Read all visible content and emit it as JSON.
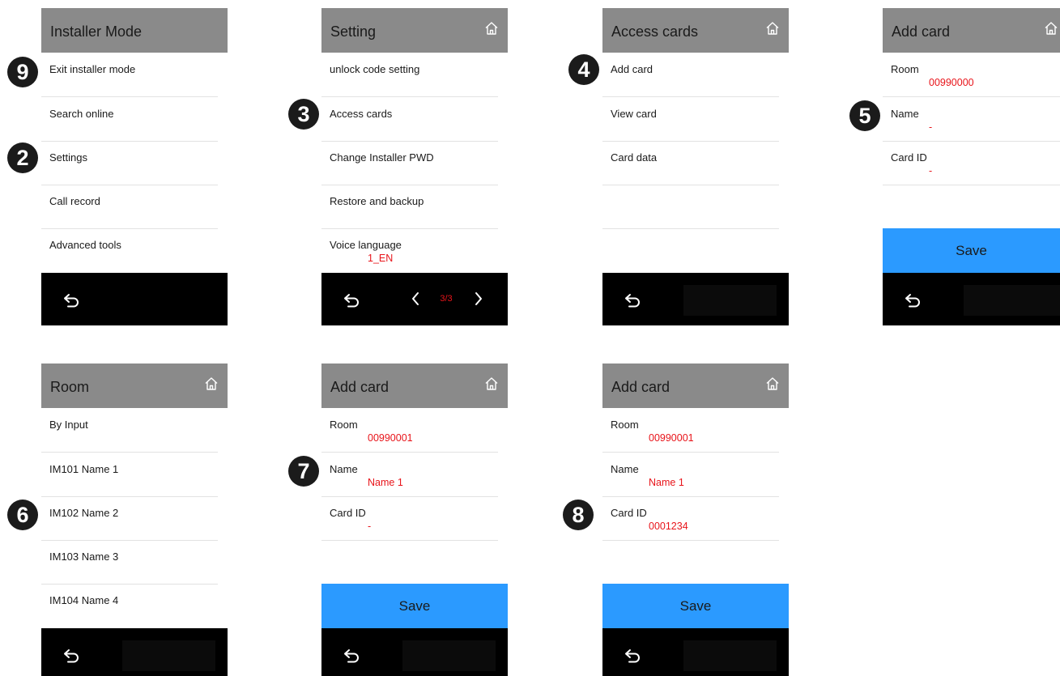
{
  "panels": {
    "installer": {
      "title": "Installer Mode",
      "items": [
        "Exit installer mode",
        "Search online",
        "Settings",
        "Call record",
        "Advanced tools"
      ]
    },
    "setting": {
      "title": "Setting",
      "items": [
        "unlock code setting",
        "Access cards",
        "Change Installer PWD",
        "Restore and backup",
        "Voice language"
      ],
      "voice_value": "1_EN",
      "page_indicator": "3/3"
    },
    "access": {
      "title": "Access cards",
      "items": [
        "Add card",
        "View card",
        "Card data"
      ]
    },
    "addcard1": {
      "title": "Add card",
      "room_label": "Room",
      "room_value": "00990000",
      "name_label": "Name",
      "name_value": "-",
      "cardid_label": "Card ID",
      "cardid_value": "-",
      "save_label": "Save"
    },
    "room": {
      "title": "Room",
      "items": [
        "By Input",
        "IM101 Name 1",
        "IM102 Name 2",
        "IM103 Name 3",
        "IM104 Name 4"
      ]
    },
    "addcard2": {
      "title": "Add card",
      "room_label": "Room",
      "room_value": "00990001",
      "name_label": "Name",
      "name_value": "Name 1",
      "cardid_label": "Card ID",
      "cardid_value": "-",
      "save_label": "Save"
    },
    "addcard3": {
      "title": "Add card",
      "room_label": "Room",
      "room_value": "00990001",
      "name_label": "Name",
      "name_value": "Name 1",
      "cardid_label": "Card ID",
      "cardid_value": "0001234",
      "save_label": "Save"
    }
  },
  "badges": [
    "9",
    "2",
    "3",
    "4",
    "5",
    "7",
    "6",
    "8"
  ],
  "icons": {
    "home": "home-icon",
    "back": "back-arrow-icon",
    "prev": "chevron-left-icon",
    "next": "chevron-right-icon"
  },
  "colors": {
    "header": "#8a8a8a",
    "value_text": "#e8141a",
    "save_button": "#2b9aff",
    "bottom_bar": "#000000"
  }
}
